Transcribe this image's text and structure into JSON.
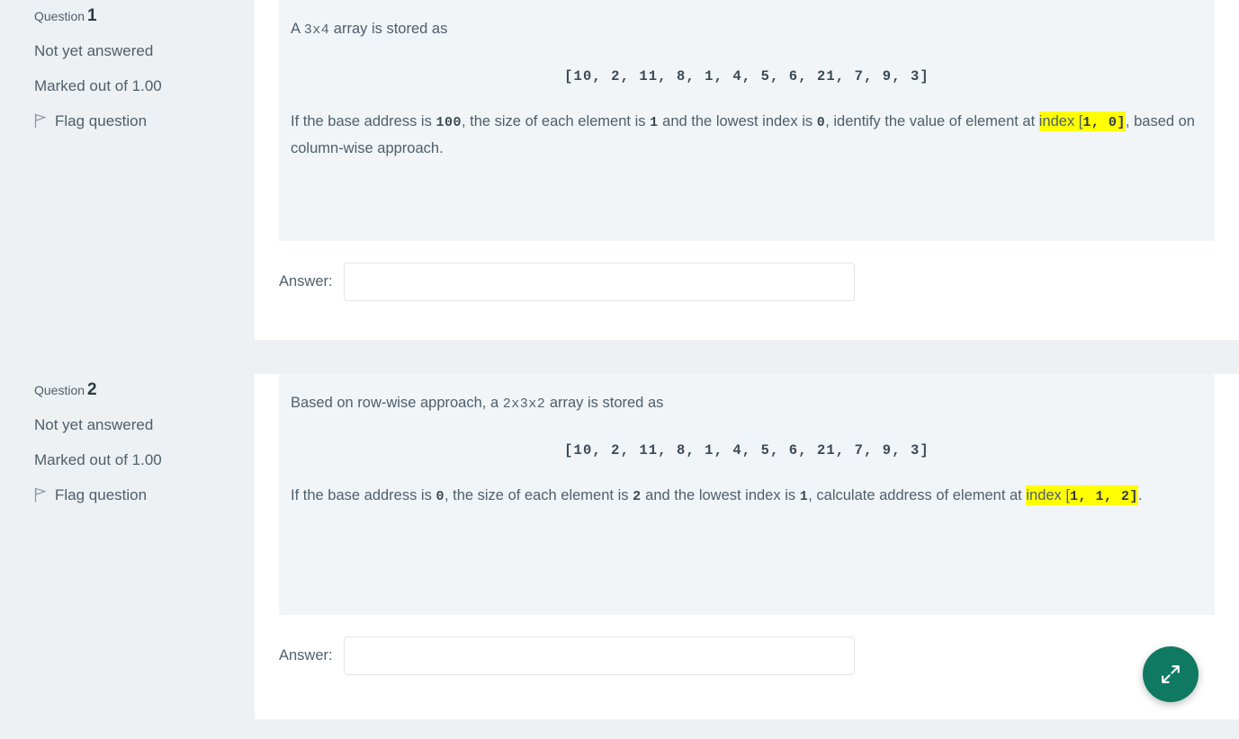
{
  "colors": {
    "page_background": "#eef1f3",
    "card_background": "#ffffff",
    "question_text_background": "#f2f5f7",
    "highlight": "#ffff00",
    "fab": "#0f7962",
    "text": "#4e5f6b"
  },
  "questions": [
    {
      "label": "Question",
      "number": "1",
      "status": "Not yet answered",
      "marked_out_of": "Marked out of 1.00",
      "flag_label": "Flag question",
      "body": {
        "intro_prefix": "A ",
        "intro_code": "3x4",
        "intro_suffix": " array is stored as",
        "array": "[10, 2, 11, 8, 1, 4, 5, 6, 21, 7, 9, 3]",
        "s1_a": "If the base address is ",
        "s1_base": "100",
        "s1_b": ", the size of each element is ",
        "s1_size": "1",
        "s1_c": " and the lowest index is ",
        "s1_lowest": "0",
        "s1_d": ", identify the value of element at ",
        "hl_word": "index [",
        "hl_code": "1,  0]",
        "s1_e": ", based on column-wise approach."
      },
      "answer_label": "Answer:",
      "answer_value": "",
      "answer_placeholder": ""
    },
    {
      "label": "Question",
      "number": "2",
      "status": "Not yet answered",
      "marked_out_of": "Marked out of 1.00",
      "flag_label": "Flag question",
      "body": {
        "intro_prefix": "Based on row-wise approach, a ",
        "intro_code": "2x3x2",
        "intro_suffix": " array is stored as",
        "array": "[10, 2, 11, 8, 1, 4, 5, 6, 21, 7, 9, 3]",
        "s1_a": "If the base address is ",
        "s1_base": "0",
        "s1_b": ", the size of each element is ",
        "s1_size": "2",
        "s1_c": " and the lowest index is ",
        "s1_lowest": "1",
        "s1_d": ", calculate address of element at ",
        "hl_word": "index [",
        "hl_code": "1,  1,  2]",
        "s1_e": "."
      },
      "answer_label": "Answer:",
      "answer_value": "",
      "answer_placeholder": ""
    }
  ],
  "fab": {
    "icon": "expand-arrows-icon",
    "title": ""
  }
}
